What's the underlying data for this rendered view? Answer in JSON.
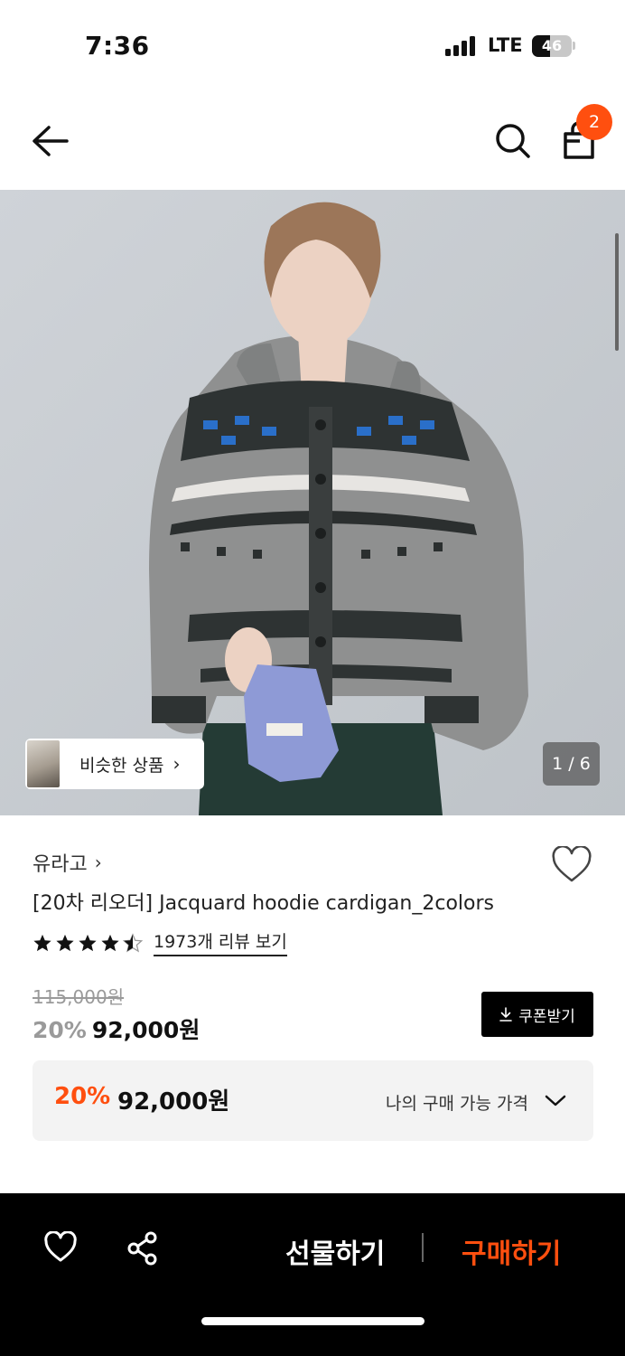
{
  "status_bar": {
    "time": "7:36",
    "network": "LTE",
    "battery": "46",
    "battery_level": 0.46
  },
  "header": {
    "cart_count": "2",
    "icons": [
      "back-arrow-icon",
      "search-icon",
      "shopping-bag-icon"
    ]
  },
  "gallery": {
    "similar_label": "비슷한 상품",
    "counter": "1 / 6"
  },
  "product": {
    "brand": "유라고",
    "title": "[20차 리오더] Jacquard hoodie cardigan_2colors",
    "rating": 4.5,
    "review_link": "1973개 리뷰 보기",
    "original_price": "115,000원",
    "discount": "20%",
    "price": "92,000원",
    "coupon_label": "쿠폰받기"
  },
  "my_price": {
    "discount": "20%",
    "price": "92,000원",
    "label": "나의 구매 가능 가격"
  },
  "bottom_bar": {
    "gift_label": "선물하기",
    "buy_label": "구매하기"
  },
  "colors": {
    "accent": "#ff4f0f",
    "bottom_bar": "#000000",
    "hero_bg": "#c7ccd1"
  }
}
